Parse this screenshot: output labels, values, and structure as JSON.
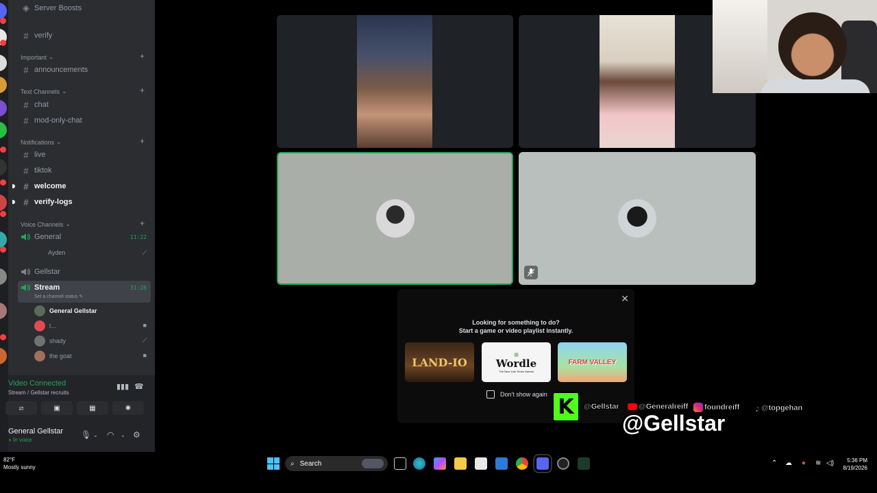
{
  "sidebar": {
    "top_item": "Server Boosts",
    "verify": "verify",
    "categories": {
      "important": "Important",
      "text": "Text Channels",
      "notifications": "Notifications",
      "voice": "Voice Channels"
    },
    "channels": {
      "announcements": "announcements",
      "chat": "chat",
      "mod_only_chat": "mod-only-chat",
      "live": "live",
      "tiktok": "tiktok",
      "welcome": "welcome",
      "verify_logs": "verify-logs"
    },
    "voice": {
      "general": "General",
      "general_timer": "11:22",
      "general_user": "Ayden",
      "gellstar": "Gellstar",
      "stream": "Stream",
      "stream_timer": "31:28",
      "stream_status": "Set a channel status",
      "stream_users": [
        "General Gellstar",
        "l...",
        "shady",
        "the goat"
      ]
    },
    "voice_panel": {
      "status": "Video Connected",
      "location": "Stream / Gellstar recruits"
    },
    "user_panel": {
      "name": "General Gellstar",
      "status": "In voice"
    }
  },
  "popup": {
    "line1": "Looking for something to do?",
    "line2": "Start a game or video playlist instantly.",
    "activities": [
      "LAND-IO",
      "Wordle",
      "FARM VALLEY"
    ],
    "wordle_sub": "The New York Times Games",
    "checkbox_label": "Don't show again"
  },
  "overlay": {
    "socials": [
      "@Gellstar",
      "@Generalreiff",
      "foundreiff",
      "@topgehan"
    ],
    "big_handle": "@Gellstar"
  },
  "taskbar": {
    "weather_temp": "82°F",
    "weather_desc": "Mostly sunny",
    "search_label": "Search",
    "time": "5:36 PM",
    "date": "8/19/2026"
  },
  "colors": {
    "sidebar_bg": "#2b2d31",
    "green": "#23a559",
    "kick_green": "#53fc18"
  }
}
